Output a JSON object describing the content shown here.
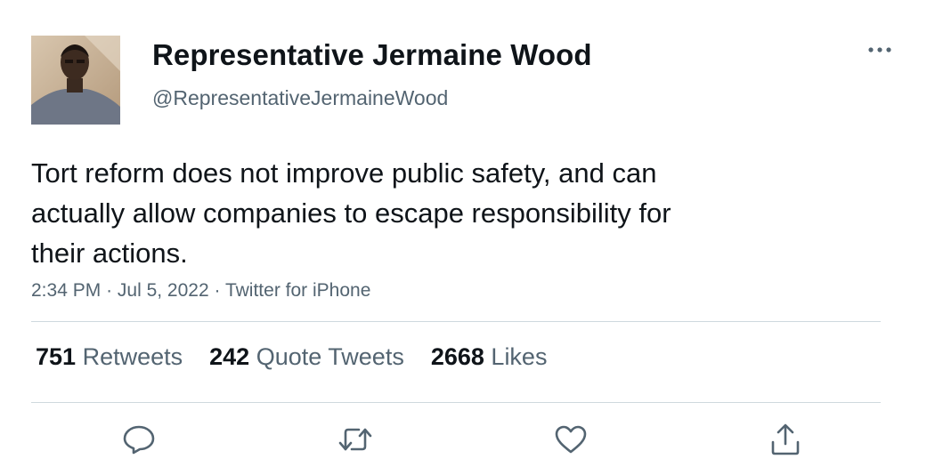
{
  "author": {
    "display_name": "Representative Jermaine Wood",
    "handle": "@RepresentativeJermaineWood"
  },
  "tweet": {
    "text_lines": [
      "Tort reform does not improve public safety, and can",
      "actually allow companies to escape responsibility for",
      "their actions."
    ],
    "time": "2:34 PM",
    "date": "Jul 5, 2022",
    "source": "Twitter for iPhone",
    "separator": "·"
  },
  "stats": {
    "retweets": {
      "count": "751",
      "label": "Retweets"
    },
    "quote_tweets": {
      "count": "242",
      "label": "Quote Tweets"
    },
    "likes": {
      "count": "2668",
      "label": "Likes"
    }
  },
  "actions": [
    "reply-icon",
    "retweet-icon",
    "like-icon",
    "share-icon"
  ],
  "colors": {
    "text_primary": "#0f1419",
    "text_secondary": "#536471",
    "divider": "#cfd9de"
  }
}
